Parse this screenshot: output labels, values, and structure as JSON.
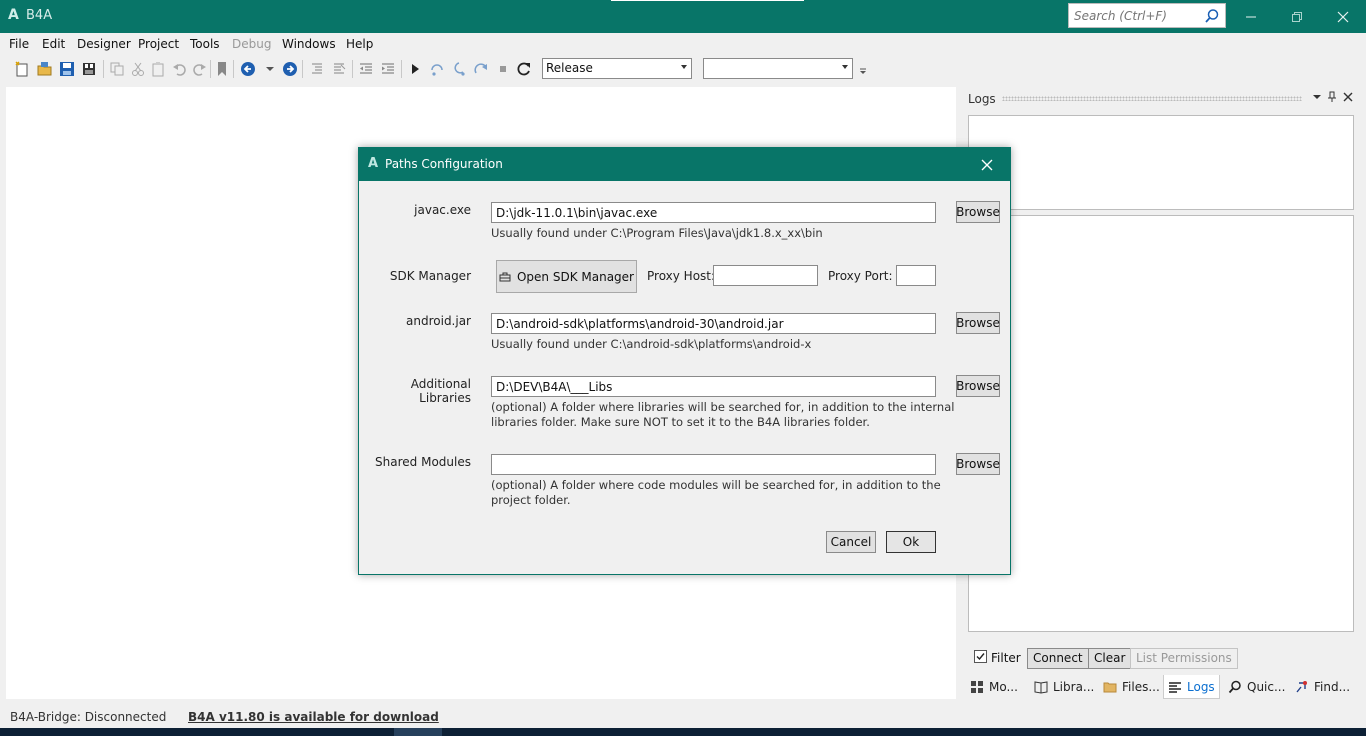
{
  "window": {
    "logo": "A",
    "title": "B4A",
    "search_placeholder": "Search (Ctrl+F)"
  },
  "menu": {
    "items": [
      "File",
      "Edit",
      "Designer",
      "Project",
      "Tools",
      "Debug",
      "Windows",
      "Help"
    ]
  },
  "toolbar": {
    "build_config": "Release",
    "device_select": ""
  },
  "logs": {
    "title": "Logs",
    "filter_label": "Filter",
    "filter_checked": true,
    "connect_label": "Connect",
    "clear_label": "Clear",
    "list_permissions_label": "List Permissions",
    "tabs": [
      "Mo...",
      "Libra...",
      "Files...",
      "Logs",
      "Quic...",
      "Find..."
    ]
  },
  "statusbar": {
    "bridge": "B4A-Bridge: Disconnected",
    "update": "B4A v11.80 is available for download"
  },
  "dialog": {
    "logo": "A",
    "title": "Paths Configuration",
    "javac": {
      "label": "javac.exe",
      "value": "D:\\jdk-11.0.1\\bin\\javac.exe",
      "hint": "Usually found under C:\\Program Files\\Java\\jdk1.8.x_xx\\bin",
      "browse": "Browse"
    },
    "sdk": {
      "label": "SDK Manager",
      "button": "Open SDK Manager",
      "proxy_host_label": "Proxy Host:",
      "proxy_host_value": "",
      "proxy_port_label": "Proxy Port:",
      "proxy_port_value": ""
    },
    "android_jar": {
      "label": "android.jar",
      "value": "D:\\android-sdk\\platforms\\android-30\\android.jar",
      "hint": "Usually found under C:\\android-sdk\\platforms\\android-x",
      "browse": "Browse"
    },
    "additional_libs": {
      "label": "Additional Libraries",
      "value": "D:\\DEV\\B4A\\___Libs",
      "hint_line1": "(optional) A folder where libraries will be searched for, in addition to the internal",
      "hint_line2": "libraries folder. Make sure NOT to set it to the B4A libraries folder.",
      "browse": "Browse"
    },
    "shared_modules": {
      "label": "Shared Modules",
      "value": "",
      "hint_line1": "(optional) A folder where code modules will be searched for, in addition to the",
      "hint_line2": "project folder.",
      "browse": "Browse"
    },
    "cancel": "Cancel",
    "ok": "Ok"
  }
}
